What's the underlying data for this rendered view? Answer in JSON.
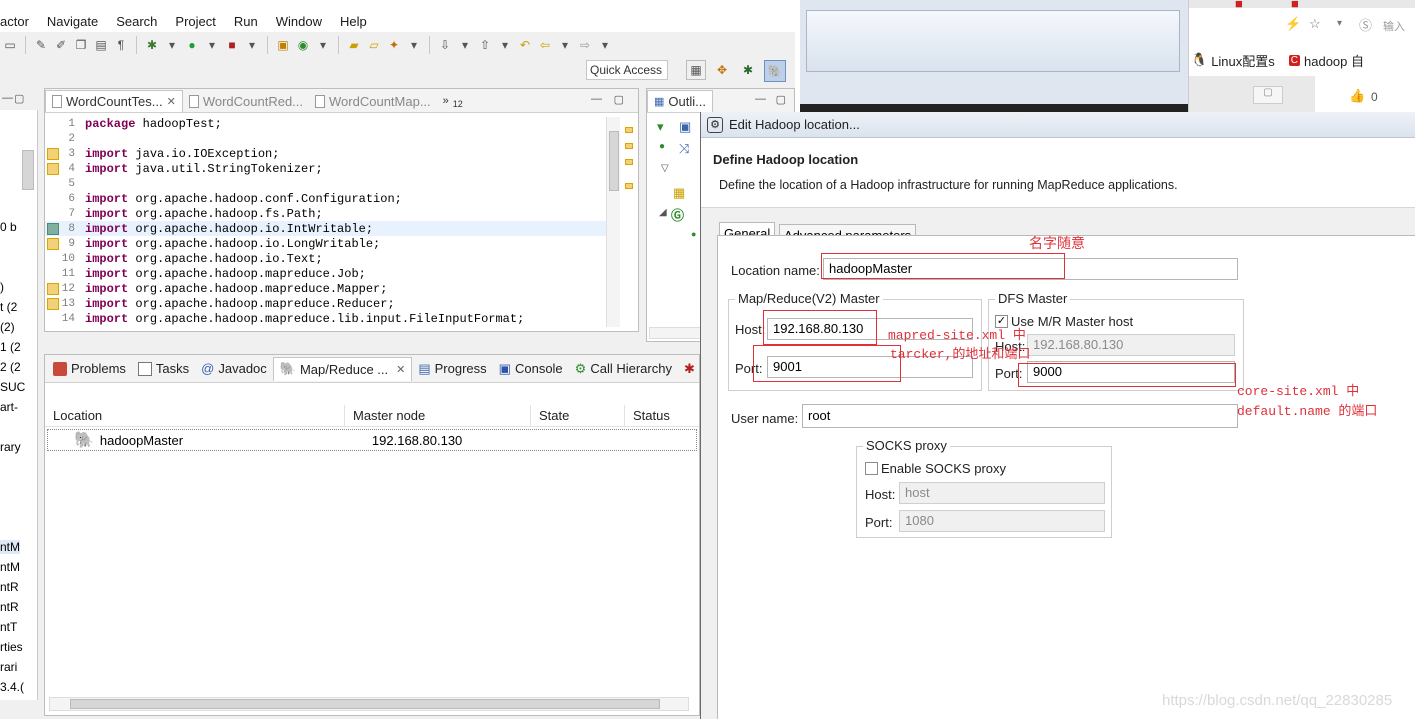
{
  "eclipse": {
    "menu": [
      "actor",
      "Navigate",
      "Search",
      "Project",
      "Run",
      "Window",
      "Help"
    ],
    "quick_access": "Quick Access",
    "left_sliver": [
      "0 b",
      ")",
      "t (2",
      "(2)",
      "1 (2",
      "2 (2",
      "SUC",
      "art-",
      "rary",
      "ntM",
      "ntM",
      "ntR",
      "ntR",
      "ntT",
      "rties",
      "rari",
      "3.4.("
    ],
    "editor": {
      "tabs": [
        "WordCountTes...",
        "WordCountRed...",
        "WordCountMap...",
        "12"
      ],
      "lines": [
        {
          "n": "1",
          "kw": "package",
          "rest": " hadoopTest;"
        },
        {
          "n": "2",
          "kw": "",
          "rest": ""
        },
        {
          "n": "3",
          "kw": "import",
          "rest": " java.io.IOException;"
        },
        {
          "n": "4",
          "kw": "import",
          "rest": " java.util.StringTokenizer;"
        },
        {
          "n": "5",
          "kw": "",
          "rest": ""
        },
        {
          "n": "6",
          "kw": "import",
          "rest": " org.apache.hadoop.conf.Configuration;"
        },
        {
          "n": "7",
          "kw": "import",
          "rest": " org.apache.hadoop.fs.Path;"
        },
        {
          "n": "8",
          "kw": "import",
          "rest": " org.apache.hadoop.io.IntWritable;"
        },
        {
          "n": "9",
          "kw": "import",
          "rest": " org.apache.hadoop.io.LongWritable;"
        },
        {
          "n": "10",
          "kw": "import",
          "rest": " org.apache.hadoop.io.Text;"
        },
        {
          "n": "11",
          "kw": "import",
          "rest": " org.apache.hadoop.mapreduce.Job;"
        },
        {
          "n": "12",
          "kw": "import",
          "rest": " org.apache.hadoop.mapreduce.Mapper;"
        },
        {
          "n": "13",
          "kw": "import",
          "rest": " org.apache.hadoop.mapreduce.Reducer;"
        },
        {
          "n": "14",
          "kw": "import",
          "rest": " org.apache.hadoop.mapreduce.lib.input.FileInputFormat;"
        }
      ]
    },
    "outline_tab": "Outli...",
    "bottom": {
      "tabs": [
        "Problems",
        "Tasks",
        "Javadoc",
        "Map/Reduce ...",
        "Progress",
        "Console",
        "Call Hierarchy"
      ],
      "columns": [
        "Location",
        "Master node",
        "State",
        "Status"
      ],
      "rows": [
        {
          "location": "hadoopMaster",
          "master_node": "192.168.80.130"
        }
      ]
    }
  },
  "browser": {
    "bookmarks": [
      "Linux配置s",
      "hadoop 自"
    ],
    "search_hint": "输入",
    "like_count": "0"
  },
  "dialog": {
    "title": "Edit Hadoop location...",
    "heading": "Define Hadoop location",
    "description": "Define the location of a Hadoop infrastructure for running MapReduce applications.",
    "tabs": [
      "General",
      "Advanced parameters"
    ],
    "location_label": "Location name:",
    "location_value": "hadoopMaster",
    "mr_group": "Map/Reduce(V2) Master",
    "mr_host_label": "Host:",
    "mr_host": "192.168.80.130",
    "mr_port_label": "Port:",
    "mr_port": "9001",
    "dfs_group": "DFS Master",
    "use_mr_host": "Use M/R Master host",
    "dfs_host_label": "Host:",
    "dfs_host": "192.168.80.130",
    "dfs_port_label": "Port:",
    "dfs_port": "9000",
    "user_label": "User name:",
    "user_value": "root",
    "socks_group": "SOCKS proxy",
    "enable_socks": "Enable SOCKS proxy",
    "socks_host_label": "Host:",
    "socks_host": "host",
    "socks_port_label": "Port:",
    "socks_port": "1080"
  },
  "annotations": {
    "name_note": "名字随意",
    "mapred_note_1": "mapred-site.xml 中",
    "mapred_note_2": "tarcker,的地址和端口",
    "core_note_1": "core-site.xml 中",
    "core_note_2": "default.name    的端口",
    "color": "#e0303a"
  },
  "watermark": "https://blog.csdn.net/qq_22830285"
}
